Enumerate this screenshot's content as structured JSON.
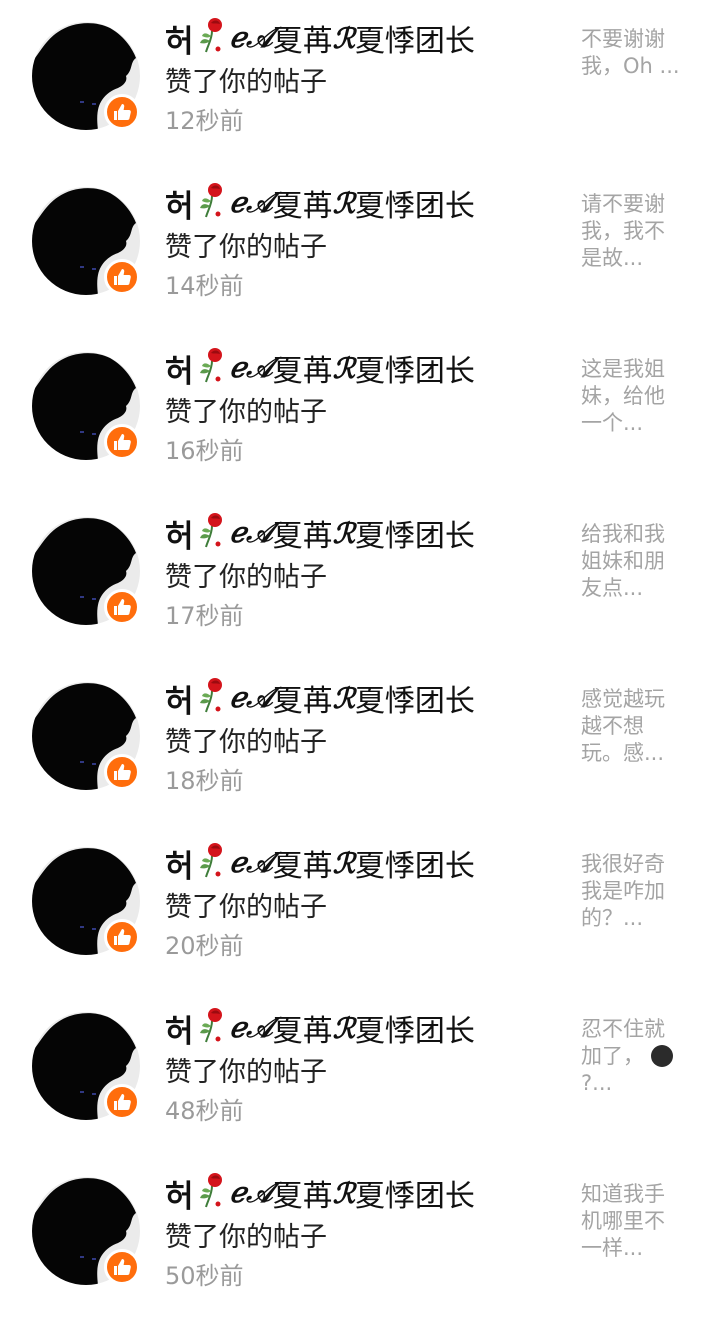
{
  "notifications": [
    {
      "name_hangul": "허",
      "name_script": "ℯ𝒜",
      "name_cjk_1": "夏苒",
      "name_script_2": "ℛ",
      "name_cjk_2": "夏悸团长",
      "action": "赞了你的帖子",
      "time": "12秒前",
      "snippet": "不要谢谢我，Oh ..."
    },
    {
      "name_hangul": "허",
      "name_script": "ℯ𝒜",
      "name_cjk_1": "夏苒",
      "name_script_2": "ℛ",
      "name_cjk_2": "夏悸团长",
      "action": "赞了你的帖子",
      "time": "14秒前",
      "snippet": "请不要谢我，我不是故..."
    },
    {
      "name_hangul": "허",
      "name_script": "ℯ𝒜",
      "name_cjk_1": "夏苒",
      "name_script_2": "ℛ",
      "name_cjk_2": "夏悸团长",
      "action": "赞了你的帖子",
      "time": "16秒前",
      "snippet": "这是我姐妹，给他一个..."
    },
    {
      "name_hangul": "허",
      "name_script": "ℯ𝒜",
      "name_cjk_1": "夏苒",
      "name_script_2": "ℛ",
      "name_cjk_2": "夏悸团长",
      "action": "赞了你的帖子",
      "time": "17秒前",
      "snippet": "给我和我姐妹和朋友点..."
    },
    {
      "name_hangul": "허",
      "name_script": "ℯ𝒜",
      "name_cjk_1": "夏苒",
      "name_script_2": "ℛ",
      "name_cjk_2": "夏悸团长",
      "action": "赞了你的帖子",
      "time": "18秒前",
      "snippet": "感觉越玩越不想玩。感..."
    },
    {
      "name_hangul": "허",
      "name_script": "ℯ𝒜",
      "name_cjk_1": "夏苒",
      "name_script_2": "ℛ",
      "name_cjk_2": "夏悸团长",
      "action": "赞了你的帖子",
      "time": "20秒前",
      "snippet": "我很好奇我是咋加的？..."
    },
    {
      "name_hangul": "허",
      "name_script": "ℯ𝒜",
      "name_cjk_1": "夏苒",
      "name_script_2": "ℛ",
      "name_cjk_2": "夏悸团长",
      "action": "赞了你的帖子",
      "time": "48秒前",
      "snippet": "忍不住就加了，",
      "snippet_tail": "?..."
    },
    {
      "name_hangul": "허",
      "name_script": "ℯ𝒜",
      "name_cjk_1": "夏苒",
      "name_script_2": "ℛ",
      "name_cjk_2": "夏悸团长",
      "action": "赞了你的帖子",
      "time": "50秒前",
      "snippet": "知道我手机哪里不一样..."
    }
  ],
  "icons": {
    "like_badge": "thumbs-up-icon",
    "name_decoration": "rose-icon",
    "snippet_emoji": "dark-face-emoji-icon"
  },
  "colors": {
    "like_badge": "#ff6d0c",
    "avatar_bg": "#ebebeb",
    "time": "#9a9a9a",
    "snippet": "#a4a4a4"
  }
}
